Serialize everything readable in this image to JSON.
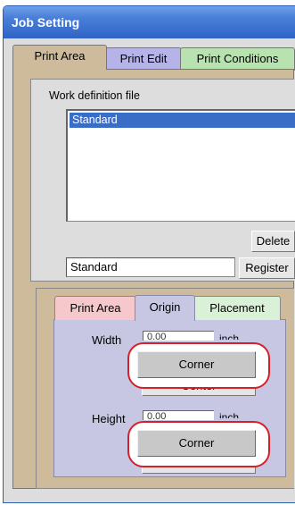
{
  "window": {
    "title": "Job Setting"
  },
  "main_tabs": [
    "Print Area",
    "Print Edit",
    "Print Conditions"
  ],
  "work_definition": {
    "label": "Work definition file",
    "list_items": [
      "Standard"
    ],
    "delete_label": "Delete",
    "name_value": "Standard",
    "register_label": "Register"
  },
  "sub_tabs": [
    "Print Area",
    "Origin",
    "Placement"
  ],
  "origin": {
    "width_label": "Width",
    "width_value": "0.00",
    "height_label": "Height",
    "height_value": "0.00",
    "unit_label": "inch",
    "corner_label": "Corner",
    "center_label": "Center"
  },
  "colors": {
    "title_bar": "#3a6ed2",
    "tab_print_area": "#e2d6b7",
    "tab_print_edit": "#b5b3e8",
    "tab_print_conditions": "#b8e2b0",
    "main_panel": "#cdbb9b",
    "subtab_print_area": "#f6c8cc",
    "subtab_origin": "#c7c7e3",
    "subtab_placement": "#d9f1d6",
    "highlight": "#d5202a"
  }
}
